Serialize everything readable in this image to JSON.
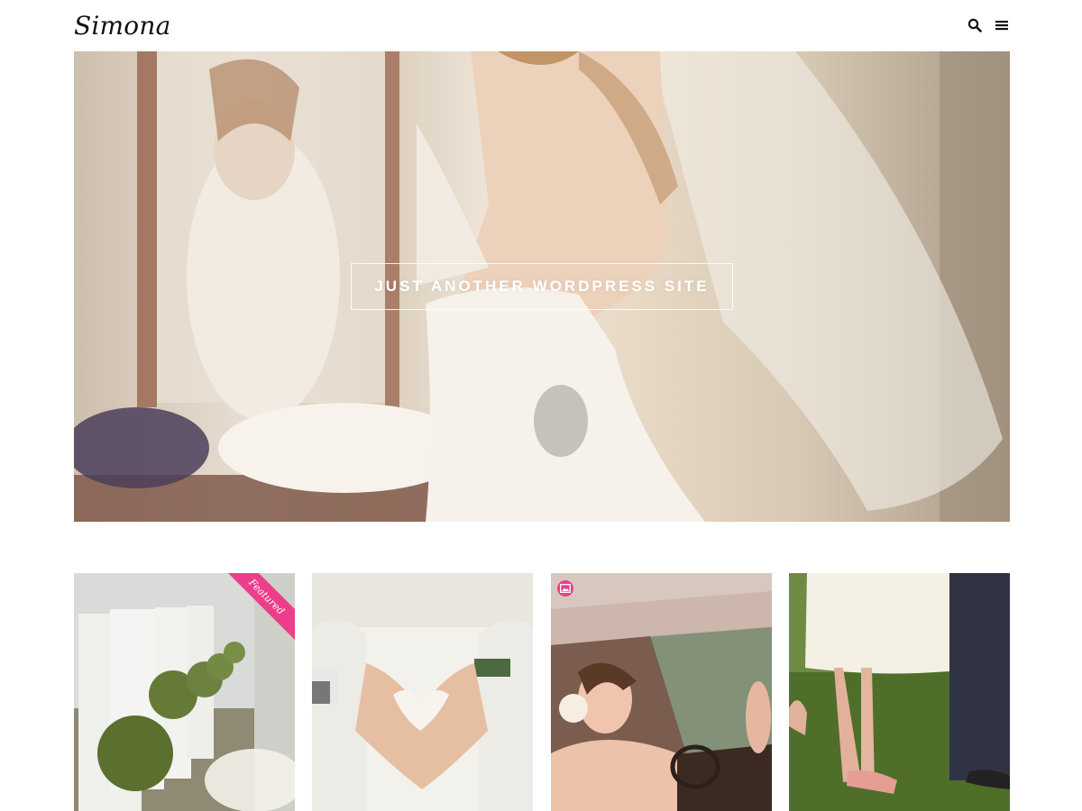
{
  "site": {
    "title": "Simona",
    "tagline": "JUST ANOTHER WORDPRESS SITE"
  },
  "header": {
    "icons": [
      "search-icon",
      "menu-icon"
    ]
  },
  "posts": [
    {
      "ribbon": "Featured",
      "image": "wedding-aisle-chairs-moss-balls"
    },
    {
      "image": "hands-heart-gesture-dress"
    },
    {
      "format_icon": "image-format-icon",
      "image": "bride-in-car"
    },
    {
      "image": "couple-legs-grass"
    }
  ],
  "colors": {
    "accent": "#ec3e8a",
    "text": "#111111",
    "background": "#ffffff"
  }
}
